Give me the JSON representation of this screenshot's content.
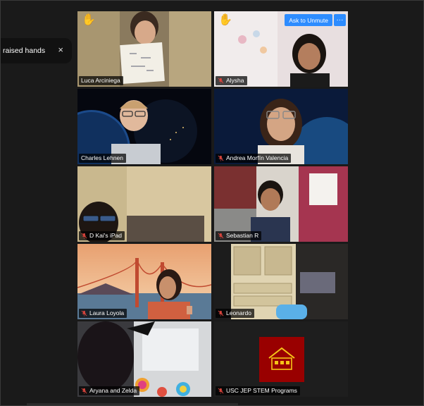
{
  "toast": {
    "text": "raised hands",
    "close_glyph": "×"
  },
  "tiles": [
    {
      "name": "Luca Arciniega",
      "hand": "✋",
      "muted": false,
      "active": true
    },
    {
      "name": "Alysha",
      "hand": "✋",
      "muted": true,
      "active": false,
      "unmute_label": "Ask to Unmute",
      "more_label": "···"
    },
    {
      "name": "Charles Lehnen",
      "muted": false
    },
    {
      "name": "Andrea Morfín Valencia",
      "muted": true
    },
    {
      "name": "D Kai's iPad",
      "muted": true
    },
    {
      "name": "Sebastian R",
      "muted": true
    },
    {
      "name": "Laura Loyola",
      "muted": true
    },
    {
      "name": "Leonardo",
      "muted": true
    },
    {
      "name": "Aryana and Zelda",
      "muted": true
    },
    {
      "name": "USC JEP STEM Programs",
      "muted": true
    }
  ],
  "colors": {
    "accent": "#2d8cff",
    "active_border": "#c8d95a",
    "muted_icon": "#e0463e"
  }
}
